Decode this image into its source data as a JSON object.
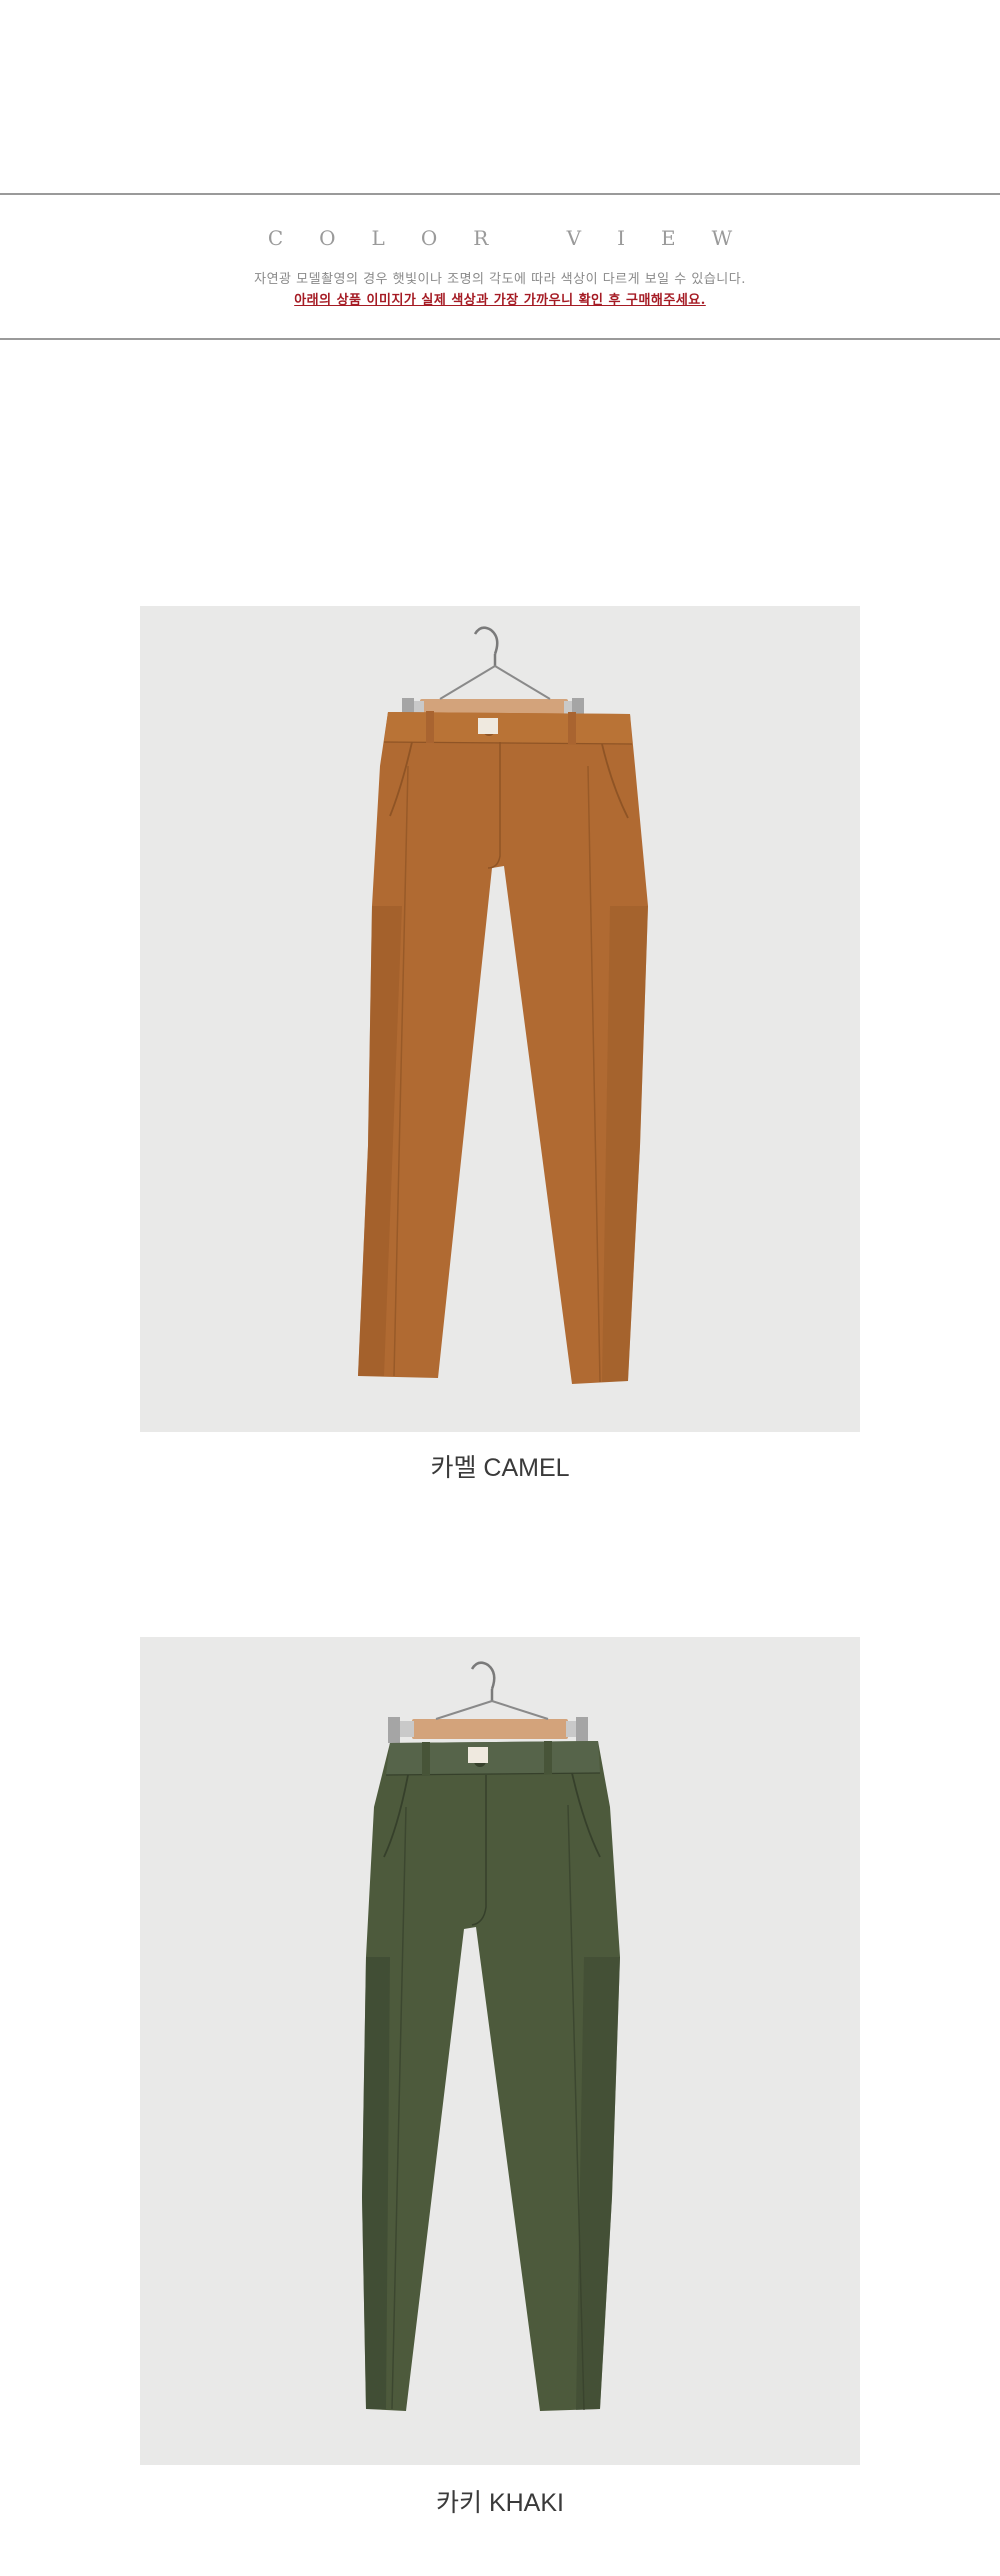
{
  "color_view": {
    "heading": "COLOR VIEW",
    "note": "자연광 모델촬영의 경우 햇빛이나 조명의 각도에 따라 색상이 다르게 보일 수 있습니다.",
    "warning": "아래의 상품 이미지가 실제 색상과 가장 가까우니 확인 후 구매해주세요."
  },
  "products": [
    {
      "caption": "카멜 CAMEL",
      "color": "#b06a32",
      "shadow": "#8f5425",
      "highlight": "#c07a3f"
    },
    {
      "caption": "카키 KHAKI",
      "color": "#4d5a3c",
      "shadow": "#3b4630",
      "highlight": "#5a6847"
    }
  ],
  "colors": {
    "background": "#e9e9e8",
    "hanger_wood": "#d3a37b",
    "rule": "#9a9a9a",
    "warning": "#a51b24"
  }
}
